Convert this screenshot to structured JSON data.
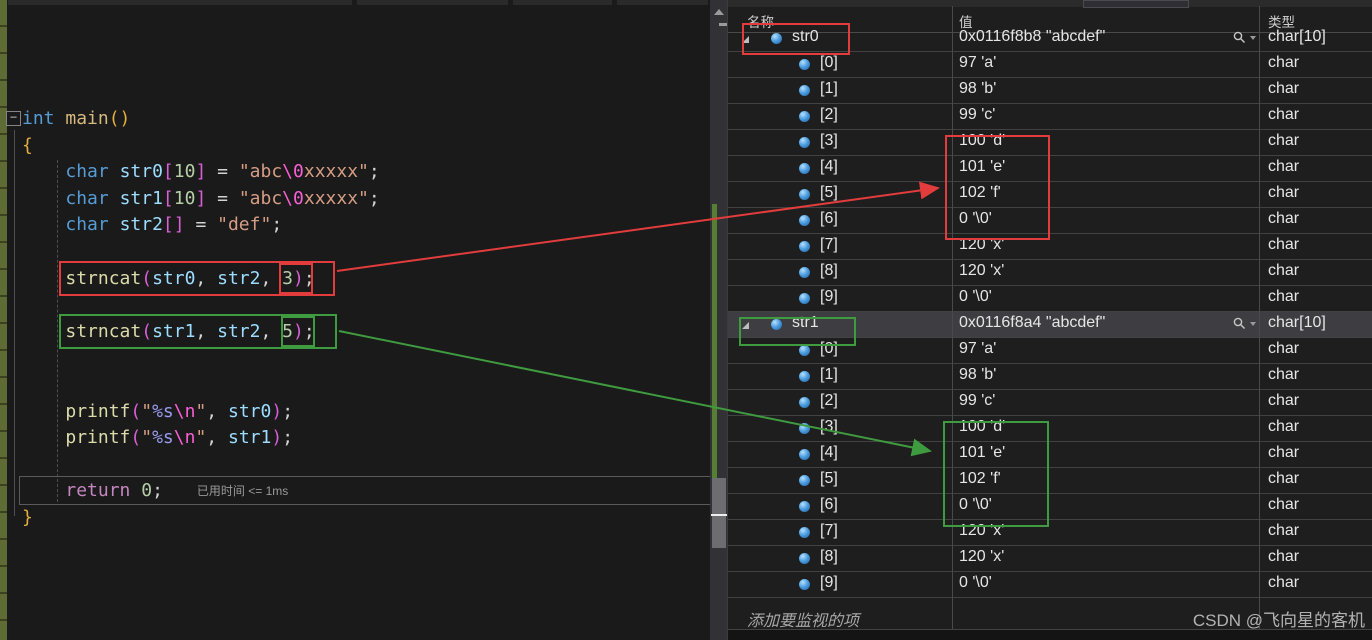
{
  "editor": {
    "fold_glyph": "−",
    "perf_tip": "已用时间 <= 1ms",
    "token_colors": {
      "kw": "#569cd6",
      "ctrl": "#c586c0",
      "fn": "#dcdcaa",
      "mainfn": "#d7ba7d",
      "var": "#9cdcfe",
      "num": "#b5cea8",
      "str": "#d69d85",
      "esc": "#f95fd4",
      "fmt": "#9a9af0",
      "plain": "#d4d4d4",
      "gold": "#e2ae3f",
      "mag": "#d85fd8"
    },
    "lines": [
      {
        "tokens": [
          [
            "kw",
            "int"
          ],
          [
            "plain",
            " "
          ],
          [
            "mainfn",
            "main"
          ],
          [
            "gold",
            "()"
          ]
        ]
      },
      {
        "tokens": [
          [
            "gold",
            "{"
          ]
        ]
      },
      {
        "tokens": [
          [
            "plain",
            "    "
          ],
          [
            "kw",
            "char"
          ],
          [
            "plain",
            " "
          ],
          [
            "var",
            "str0"
          ],
          [
            "mag",
            "["
          ],
          [
            "num",
            "10"
          ],
          [
            "mag",
            "]"
          ],
          [
            "plain",
            " = "
          ],
          [
            "str",
            "\"abc"
          ],
          [
            "esc",
            "\\0"
          ],
          [
            "str",
            "xxxxx\""
          ],
          [
            "plain",
            ";"
          ]
        ]
      },
      {
        "tokens": [
          [
            "plain",
            "    "
          ],
          [
            "kw",
            "char"
          ],
          [
            "plain",
            " "
          ],
          [
            "var",
            "str1"
          ],
          [
            "mag",
            "["
          ],
          [
            "num",
            "10"
          ],
          [
            "mag",
            "]"
          ],
          [
            "plain",
            " = "
          ],
          [
            "str",
            "\"abc"
          ],
          [
            "esc",
            "\\0"
          ],
          [
            "str",
            "xxxxx\""
          ],
          [
            "plain",
            ";"
          ]
        ]
      },
      {
        "tokens": [
          [
            "plain",
            "    "
          ],
          [
            "kw",
            "char"
          ],
          [
            "plain",
            " "
          ],
          [
            "var",
            "str2"
          ],
          [
            "mag",
            "[]"
          ],
          [
            "plain",
            " = "
          ],
          [
            "str",
            "\"def\""
          ],
          [
            "plain",
            ";"
          ]
        ]
      },
      {
        "tokens": []
      },
      {
        "tokens": [
          [
            "plain",
            "    "
          ],
          [
            "fn",
            "strncat"
          ],
          [
            "mag",
            "("
          ],
          [
            "var",
            "str0"
          ],
          [
            "plain",
            ", "
          ],
          [
            "var",
            "str2"
          ],
          [
            "plain",
            ", "
          ],
          [
            "num",
            "3"
          ],
          [
            "mag",
            ")"
          ],
          [
            "plain",
            ";"
          ]
        ]
      },
      {
        "tokens": []
      },
      {
        "tokens": [
          [
            "plain",
            "    "
          ],
          [
            "fn",
            "strncat"
          ],
          [
            "mag",
            "("
          ],
          [
            "var",
            "str1"
          ],
          [
            "plain",
            ", "
          ],
          [
            "var",
            "str2"
          ],
          [
            "plain",
            ", "
          ],
          [
            "num",
            "5"
          ],
          [
            "mag",
            ")"
          ],
          [
            "plain",
            ";"
          ]
        ]
      },
      {
        "tokens": []
      },
      {
        "tokens": []
      },
      {
        "tokens": [
          [
            "plain",
            "    "
          ],
          [
            "fn",
            "printf"
          ],
          [
            "mag",
            "("
          ],
          [
            "str",
            "\""
          ],
          [
            "fmt",
            "%s"
          ],
          [
            "esc",
            "\\n"
          ],
          [
            "str",
            "\""
          ],
          [
            "plain",
            ", "
          ],
          [
            "var",
            "str0"
          ],
          [
            "mag",
            ")"
          ],
          [
            "plain",
            ";"
          ]
        ]
      },
      {
        "tokens": [
          [
            "plain",
            "    "
          ],
          [
            "fn",
            "printf"
          ],
          [
            "mag",
            "("
          ],
          [
            "str",
            "\""
          ],
          [
            "fmt",
            "%s"
          ],
          [
            "esc",
            "\\n"
          ],
          [
            "str",
            "\""
          ],
          [
            "plain",
            ", "
          ],
          [
            "var",
            "str1"
          ],
          [
            "mag",
            ")"
          ],
          [
            "plain",
            ";"
          ]
        ]
      },
      {
        "tokens": []
      },
      {
        "tokens": [
          [
            "plain",
            "    "
          ],
          [
            "ctrl",
            "return"
          ],
          [
            "plain",
            " "
          ],
          [
            "num",
            "0"
          ],
          [
            "plain",
            ";"
          ]
        ],
        "perftip": true
      },
      {
        "tokens": [
          [
            "gold",
            "}"
          ]
        ]
      }
    ]
  },
  "watch": {
    "columns": [
      "名称",
      "值",
      "类型"
    ],
    "rows": [
      {
        "level": 0,
        "expanded": true,
        "name": "str0",
        "value": "0x0116f8b8 \"abcdef\"",
        "type": "char[10]",
        "magnifier": true,
        "selected": false
      },
      {
        "level": 1,
        "name": "[0]",
        "value": "97 'a'",
        "type": "char"
      },
      {
        "level": 1,
        "name": "[1]",
        "value": "98 'b'",
        "type": "char"
      },
      {
        "level": 1,
        "name": "[2]",
        "value": "99 'c'",
        "type": "char"
      },
      {
        "level": 1,
        "name": "[3]",
        "value": "100 'd'",
        "type": "char"
      },
      {
        "level": 1,
        "name": "[4]",
        "value": "101 'e'",
        "type": "char"
      },
      {
        "level": 1,
        "name": "[5]",
        "value": "102 'f'",
        "type": "char"
      },
      {
        "level": 1,
        "name": "[6]",
        "value": "0 '\\0'",
        "type": "char"
      },
      {
        "level": 1,
        "name": "[7]",
        "value": "120 'x'",
        "type": "char"
      },
      {
        "level": 1,
        "name": "[8]",
        "value": "120 'x'",
        "type": "char"
      },
      {
        "level": 1,
        "name": "[9]",
        "value": "0 '\\0'",
        "type": "char"
      },
      {
        "level": 0,
        "expanded": true,
        "name": "str1",
        "value": "0x0116f8a4 \"abcdef\"",
        "type": "char[10]",
        "magnifier": true,
        "selected": true
      },
      {
        "level": 1,
        "name": "[0]",
        "value": "97 'a'",
        "type": "char"
      },
      {
        "level": 1,
        "name": "[1]",
        "value": "98 'b'",
        "type": "char"
      },
      {
        "level": 1,
        "name": "[2]",
        "value": "99 'c'",
        "type": "char"
      },
      {
        "level": 1,
        "name": "[3]",
        "value": "100 'd'",
        "type": "char"
      },
      {
        "level": 1,
        "name": "[4]",
        "value": "101 'e'",
        "type": "char"
      },
      {
        "level": 1,
        "name": "[5]",
        "value": "102 'f'",
        "type": "char"
      },
      {
        "level": 1,
        "name": "[6]",
        "value": "0 '\\0'",
        "type": "char"
      },
      {
        "level": 1,
        "name": "[7]",
        "value": "120 'x'",
        "type": "char"
      },
      {
        "level": 1,
        "name": "[8]",
        "value": "120 'x'",
        "type": "char"
      },
      {
        "level": 1,
        "name": "[9]",
        "value": "0 '\\0'",
        "type": "char"
      }
    ],
    "add_row_label": "添加要监视的项"
  },
  "annotations": {
    "red_color": "#e23c3c",
    "green_color": "#3f9b3f",
    "red_boxes": [
      "strncat(str0, str2, 3); call",
      "arg 3",
      "str0 name",
      "str0 values [3]-[6]"
    ],
    "green_boxes": [
      "strncat(str1, str2, 5); call",
      "arg 5",
      "str1 name",
      "str1 values [3]-[6]"
    ]
  },
  "watermark": "CSDN @飞向星的客机"
}
